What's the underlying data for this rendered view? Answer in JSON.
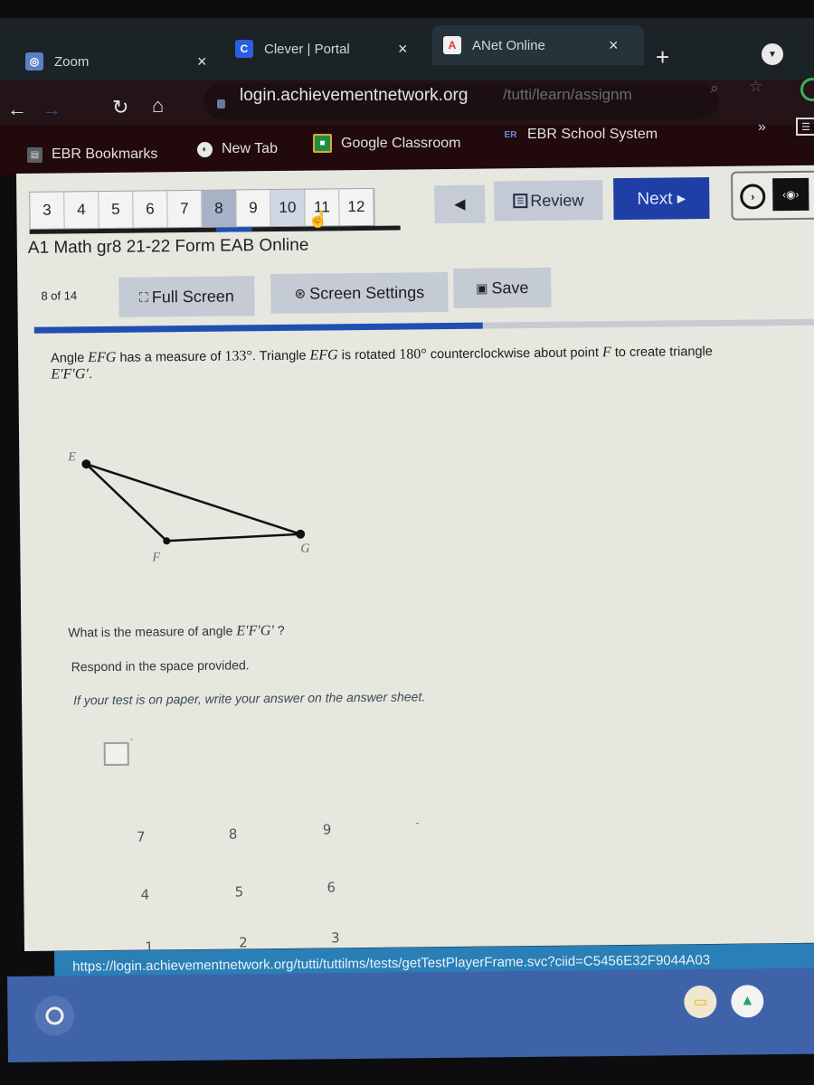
{
  "browser": {
    "tabs": [
      {
        "title": "Zoom",
        "favicon": "zoom-icon",
        "favicon_color": "#5a7fc4"
      },
      {
        "title": "Clever | Portal",
        "favicon": "clever-icon",
        "favicon_color": "#2b5fe0"
      },
      {
        "title": "ANet Online",
        "favicon": "anet-icon",
        "favicon_color": "#d9392b"
      }
    ],
    "close_glyph": "×",
    "new_tab_glyph": "+",
    "url_host": "login.achievementnetwork.org",
    "url_path": "/tutti/learn/assignm",
    "bookmarks": [
      {
        "label": "EBR Bookmarks",
        "icon": "folder-icon"
      },
      {
        "label": "New Tab",
        "icon": "globe-icon"
      },
      {
        "label": "Google Classroom",
        "icon": "classroom-icon"
      },
      {
        "label": "EBR School System",
        "icon": "ebr-icon"
      }
    ],
    "more_bookmarks_glyph": "»"
  },
  "test": {
    "question_numbers": [
      "3",
      "4",
      "5",
      "6",
      "7",
      "8",
      "9",
      "10",
      "11",
      "12"
    ],
    "current_question": "8",
    "hovered_question": "10",
    "prev_glyph": "◀",
    "review_label": "Review",
    "next_label": "Next ▸",
    "title": "A1 Math gr8 21-22 Form EAB Online",
    "question_count": "8 of 14",
    "full_screen_label": "Full Screen",
    "screen_settings_label": "Screen Settings",
    "save_label": "Save",
    "progress": 0.57,
    "accent": "#1f3fa6"
  },
  "question": {
    "stem_parts": {
      "p1": "Angle ",
      "angle": "EFG",
      "p2": " has a measure of ",
      "measure": "133°",
      "p3": ". Triangle ",
      "triangle": "EFG",
      "p4": " is rotated ",
      "rotation": "180°",
      "p5": " counterclockwise about point ",
      "point": "F",
      "p6": " to create triangle ",
      "image": "E′F′G′",
      "p7": "."
    },
    "figure_labels": {
      "e": "E",
      "f": "F",
      "g": "G"
    },
    "prompt": "What is the measure of angle ",
    "prompt_angle": "E′F′G′",
    "prompt_end": " ?",
    "respond": "Respond in the space provided.",
    "paper_note": "If your test is on paper, write your answer on the answer sheet.",
    "answer_value": "",
    "answer_unit": "°",
    "keypad": [
      "7",
      "8",
      "9",
      "-",
      "4",
      "5",
      "6",
      "1",
      "2",
      "3"
    ]
  },
  "status_bar": {
    "url": "https://login.achievementnetwork.org/tutti/tuttilms/tests/getTestPlayerFrame.svc?ciid=C5456E32F9044A03"
  }
}
